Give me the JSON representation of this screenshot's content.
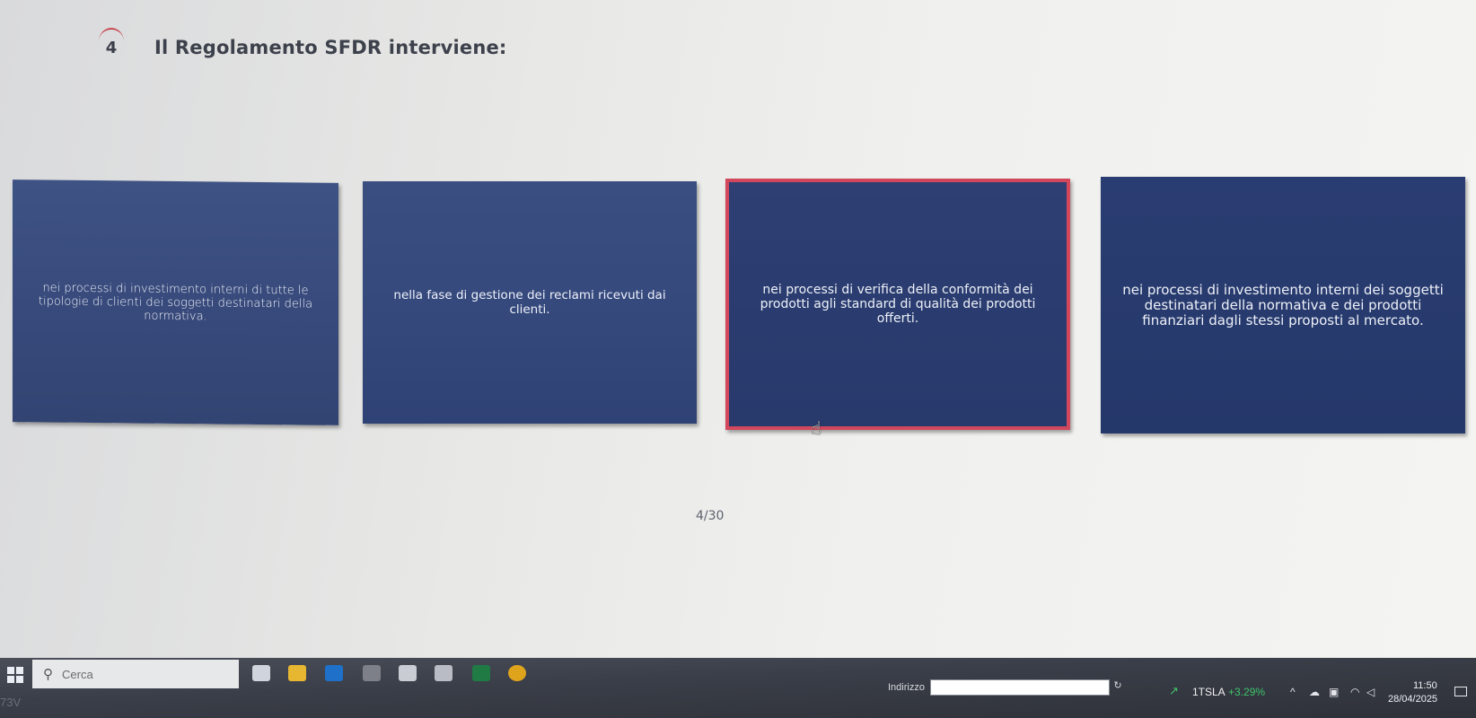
{
  "question": {
    "number": "4",
    "title": "Il Regolamento SFDR interviene:"
  },
  "options": [
    {
      "text": "nei processi di investimento interni di tutte le tipologie di clienti dei soggetti destinatari della normativa.",
      "selected": false
    },
    {
      "text": "nella fase di gestione dei reclami ricevuti dai clienti.",
      "selected": false
    },
    {
      "text": "nei processi di verifica della conformità dei prodotti agli standard di qualità dei prodotti offerti.",
      "selected": true
    },
    {
      "text": "nei processi di investimento interni dei soggetti destinatari della normativa e dei prodotti finanziari dagli stessi proposti al mercato.",
      "selected": false
    }
  ],
  "progress": "4/30",
  "colors": {
    "option_background": "#34487c",
    "selected_border": "#d2475b",
    "header_text": "#3d414b",
    "taskbar": "#3a3e48",
    "ticker_positive": "#3fc46a"
  },
  "taskbar": {
    "search_placeholder": "Cerca",
    "search_icon": "search-icon",
    "apps": [
      {
        "name": "task-view-icon",
        "color": "#d0d4dc"
      },
      {
        "name": "file-explorer-icon",
        "color": "#e8b731"
      },
      {
        "name": "outlook-icon",
        "color": "#1e70c9"
      },
      {
        "name": "calculator-icon",
        "color": "#7d8088"
      },
      {
        "name": "teams-icon",
        "color": "#c9ccd2"
      },
      {
        "name": "printer-icon",
        "color": "#b9bcc4"
      },
      {
        "name": "excel-icon",
        "color": "#1f7a44"
      },
      {
        "name": "chrome-icon",
        "color": "#e0a41c"
      }
    ],
    "bottom_left_text": "73V",
    "address_label": "Indirizzo",
    "ticker_symbol": "1TSLA",
    "ticker_change": "+3.29%",
    "time": "11:50",
    "date": "28/04/2025"
  }
}
